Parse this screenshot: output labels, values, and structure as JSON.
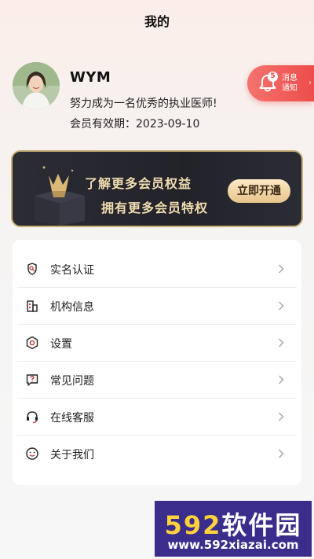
{
  "header": {
    "title": "我的"
  },
  "profile": {
    "username": "WYM",
    "motto": "努力成为一名优秀的执业医师!",
    "expiry": "会员有效期：2023-09-10"
  },
  "notification": {
    "count": "5",
    "label_line1": "消息",
    "label_line2": "通知",
    "arrow": "›"
  },
  "vip_banner": {
    "line1": "了解更多会员权益",
    "line2": "拥有更多会员特权",
    "button_label": "立即开通"
  },
  "menu": {
    "items": [
      {
        "label": "实名认证",
        "icon": "verify-icon"
      },
      {
        "label": "机构信息",
        "icon": "building-icon"
      },
      {
        "label": "设置",
        "icon": "gear-icon"
      },
      {
        "label": "常见问题",
        "icon": "question-icon"
      },
      {
        "label": "在线客服",
        "icon": "headset-icon"
      },
      {
        "label": "关于我们",
        "icon": "smile-icon"
      }
    ]
  },
  "watermark": {
    "brand_num": "592",
    "brand_text": "软件园",
    "url": "www.592xiazai.com"
  },
  "colors": {
    "accent": "#ee4d4b",
    "vip_gold": "#f1dcb0",
    "vip_bg": "#2c2c34"
  }
}
